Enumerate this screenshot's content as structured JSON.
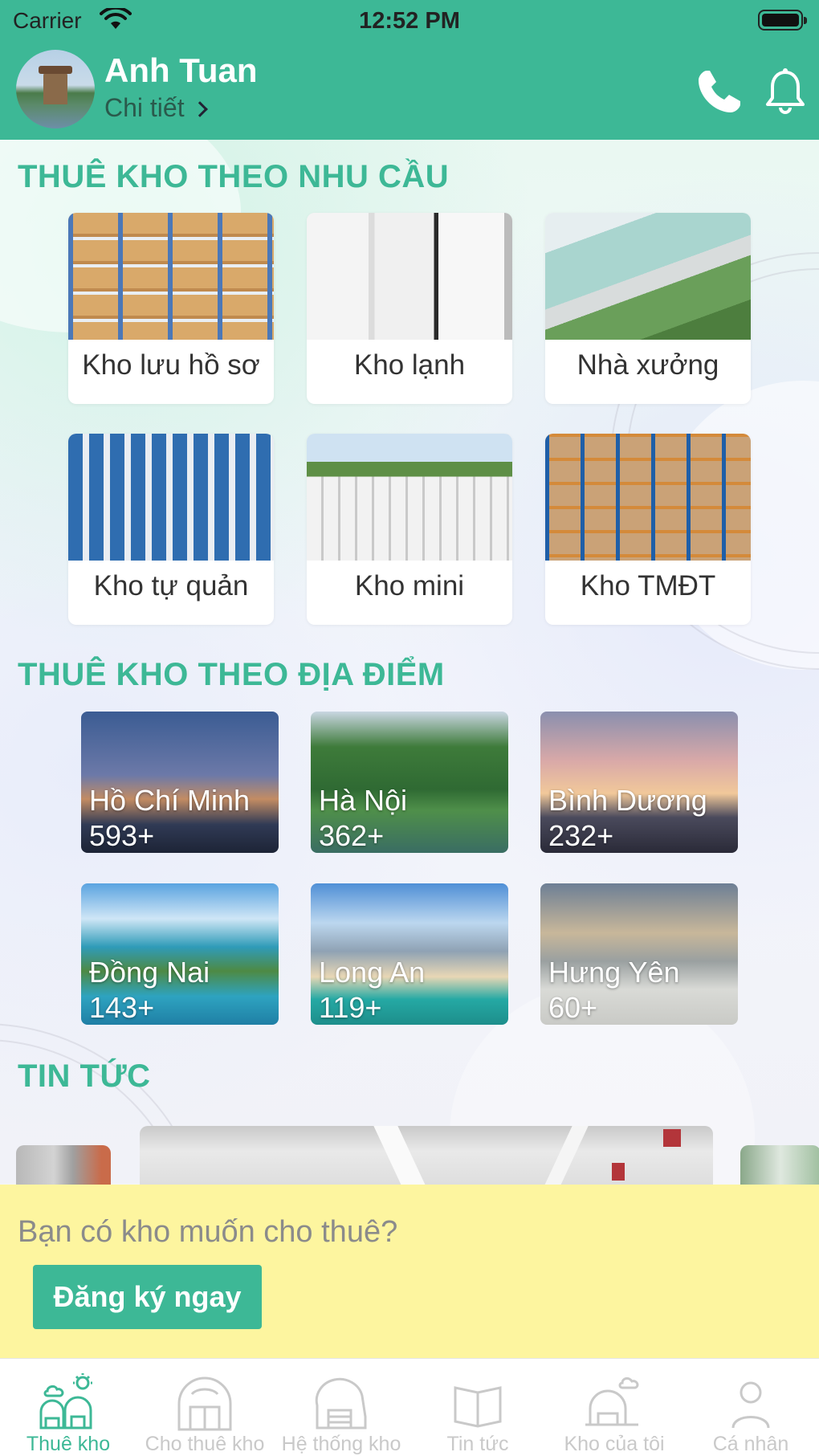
{
  "status_bar": {
    "carrier": "Carrier",
    "time": "12:52 PM"
  },
  "header": {
    "user_name": "Anh Tuan",
    "detail_label": "Chi tiết",
    "icons": [
      "phone-icon",
      "bell-icon"
    ]
  },
  "sections": {
    "need_title": "THUÊ KHO THEO NHU CẦU",
    "location_title": "THUÊ KHO THEO ĐỊA ĐIỂM",
    "news_title": "TIN TỨC"
  },
  "need_cards": [
    {
      "label": "Kho lưu hồ sơ"
    },
    {
      "label": "Kho lạnh"
    },
    {
      "label": "Nhà xưởng"
    },
    {
      "label": "Kho tự quản"
    },
    {
      "label": "Kho mini"
    },
    {
      "label": "Kho TMĐT"
    }
  ],
  "locations": [
    {
      "city": "Hồ Chí Minh",
      "count": "593+"
    },
    {
      "city": "Hà Nội",
      "count": "362+"
    },
    {
      "city": "Bình Dương",
      "count": "232+"
    },
    {
      "city": "Đồng Nai",
      "count": "143+"
    },
    {
      "city": "Long An",
      "count": "119+"
    },
    {
      "city": "Hưng Yên",
      "count": "60+"
    }
  ],
  "banner": {
    "text": "Bạn có kho muốn cho thuê?",
    "button_label": "Đăng ký ngay"
  },
  "tabs": [
    {
      "label": "Thuê kho",
      "active": true
    },
    {
      "label": "Cho thuê kho",
      "active": false
    },
    {
      "label": "Hệ thống kho",
      "active": false
    },
    {
      "label": "Tin tức",
      "active": false
    },
    {
      "label": "Kho của tôi",
      "active": false
    },
    {
      "label": "Cá nhân",
      "active": false
    }
  ],
  "colors": {
    "accent": "#3db896",
    "banner": "#fdf59f",
    "inactive_tab": "#c9c9c9"
  }
}
